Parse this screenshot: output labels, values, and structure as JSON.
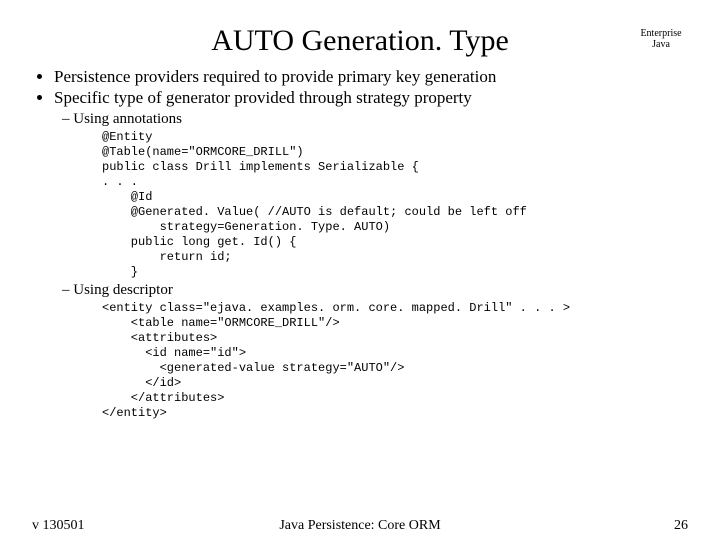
{
  "header": {
    "title": "AUTO Generation. Type",
    "corner_line1": "Enterprise",
    "corner_line2": "Java"
  },
  "bullets": {
    "b1": "Persistence providers required to provide primary key generation",
    "b2": "Specific type of generator provided through strategy property",
    "sub1": "Using annotations",
    "sub2": "Using descriptor"
  },
  "code": {
    "annotations": "@Entity\n@Table(name=\"ORMCORE_DRILL\")\npublic class Drill implements Serializable {\n. . .\n    @Id\n    @Generated. Value( //AUTO is default; could be left off\n        strategy=Generation. Type. AUTO)\n    public long get. Id() {\n        return id;\n    }",
    "descriptor": "<entity class=\"ejava. examples. orm. core. mapped. Drill\" . . . >\n    <table name=\"ORMCORE_DRILL\"/>\n    <attributes>\n      <id name=\"id\">\n        <generated-value strategy=\"AUTO\"/>\n      </id>\n    </attributes>\n</entity>"
  },
  "footer": {
    "left": "v 130501",
    "center": "Java Persistence: Core ORM",
    "right": "26"
  }
}
